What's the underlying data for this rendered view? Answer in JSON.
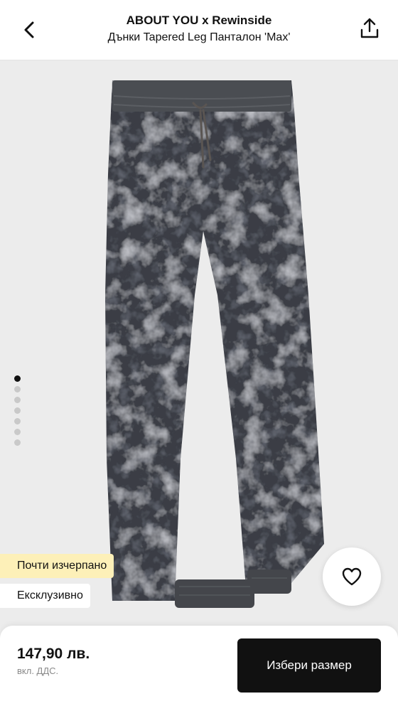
{
  "header": {
    "brand": "ABOUT YOU x Rewinside",
    "product_name": "Дънки Tapered Leg Панталон 'Max'",
    "back_icon": "chevron-left-icon",
    "share_icon": "share-icon"
  },
  "gallery": {
    "image_count": 7,
    "active_index": 0,
    "product_colors": {
      "base": "#3a3d44",
      "dark": "#23252b",
      "light": "#8a8d92",
      "accent": "#3d4a66"
    }
  },
  "badges": {
    "low_stock": "Почти изчерпано",
    "exclusive": "Ексклузивно",
    "low_stock_color": "#fdf0b8"
  },
  "wishlist": {
    "icon": "heart-icon"
  },
  "purchase": {
    "price": "147,90 лв.",
    "vat_note": "вкл. ДДС.",
    "cta_label": "Избери размер",
    "cta_color": "#111111"
  }
}
